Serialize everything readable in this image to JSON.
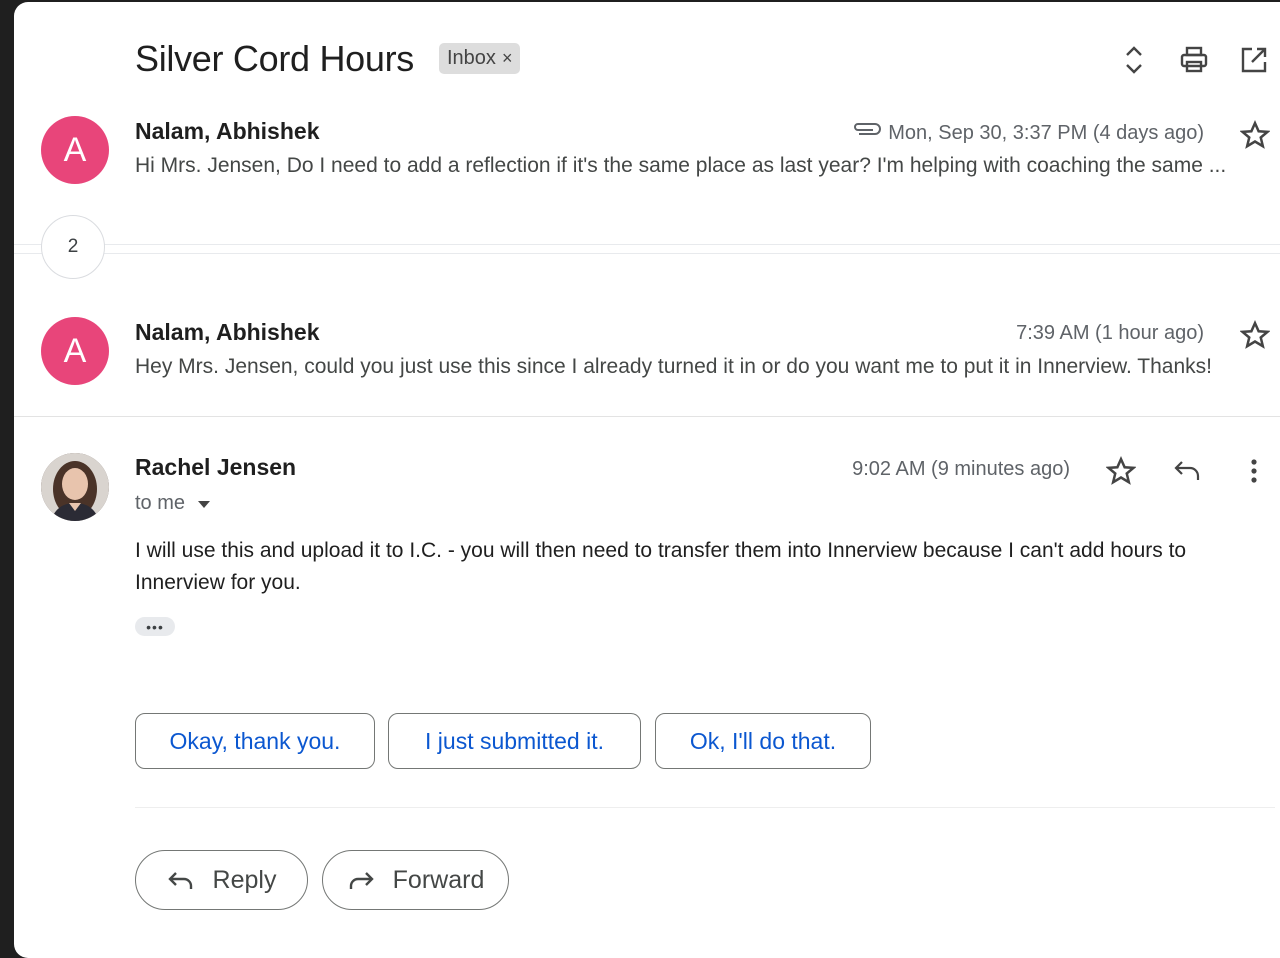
{
  "thread": {
    "subject": "Silver Cord Hours",
    "label_chip": "Inbox",
    "label_remove": "×",
    "icons": [
      "expand-collapse-icon",
      "print-icon",
      "open-in-new-window-icon"
    ]
  },
  "messages": [
    {
      "avatar_letter": "A",
      "avatar_color": "#e8457a",
      "sender": "Nalam, Abhishek",
      "date": "Mon, Sep 30, 3:37 PM (4 days ago)",
      "has_attachment": true,
      "snippet": "Hi Mrs. Jensen, Do I need to add a reflection if it's the same place as last year? I'm helping with coaching the same ..."
    },
    {
      "avatar_letter": "A",
      "avatar_color": "#e8457a",
      "sender": "Nalam, Abhishek",
      "date": "7:39 AM (1 hour ago)",
      "snippet": "Hey Mrs. Jensen, could you just use this since I already turned it in or do you want me to put it in Innerview. Thanks!"
    }
  ],
  "collapsed_count": "2",
  "open_message": {
    "sender": "Rachel Jensen",
    "date": "9:02 AM (9 minutes ago)",
    "recipient": "to me",
    "body": "I will use this and upload it to I.C. - you will then need to transfer them into Innerview because I can't add hours to Innerview for you.",
    "show_trimmed": "•••"
  },
  "smart_replies": [
    "Okay, thank you.",
    "I just submitted it.",
    "Ok, I'll do that."
  ],
  "actions": {
    "reply": "Reply",
    "forward": "Forward"
  },
  "colors": {
    "accent_blue": "#0b57d0",
    "avatar_pink": "#e8457a"
  }
}
